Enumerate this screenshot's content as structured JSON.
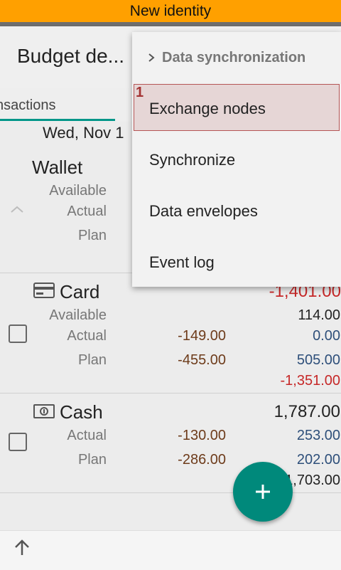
{
  "banner": {
    "text": "New identity"
  },
  "appbar": {
    "title": "Budget de..."
  },
  "tabs": {
    "active_label": "nsactions"
  },
  "date_header": "Wed, Nov 1",
  "wallet": {
    "name": "Wallet",
    "labels": [
      "Available",
      "Actual",
      "Plan"
    ]
  },
  "card": {
    "name": "Card",
    "balance": "-1,401.00",
    "labels": [
      "Available",
      "Actual",
      "Plan"
    ],
    "available_right": "114.00",
    "actual_mid": "-149.00",
    "actual_right": "0.00",
    "plan_mid": "-455.00",
    "plan_right": "505.00",
    "extra_right": "-1,351.00"
  },
  "cash": {
    "name": "Cash",
    "balance": "1,787.00",
    "labels": [
      "Actual",
      "Plan"
    ],
    "actual_mid": "-130.00",
    "actual_right": "253.00",
    "plan_mid": "-286.00",
    "plan_right": "202.00",
    "extra_right": "1,703.00"
  },
  "fab": {
    "label": "+"
  },
  "bottom": {
    "up_icon": "arrow-up-icon"
  },
  "menu": {
    "header": "Data synchronization",
    "badge": "1",
    "items": [
      "Exchange nodes",
      "Synchronize",
      "Data envelopes",
      "Event log"
    ]
  },
  "colors": {
    "banner": "#ffa000",
    "accent": "#009688",
    "fab": "#00897b",
    "negative": "#c62828",
    "planned": "#6d3b1a",
    "positive": "#2e4f7a"
  }
}
